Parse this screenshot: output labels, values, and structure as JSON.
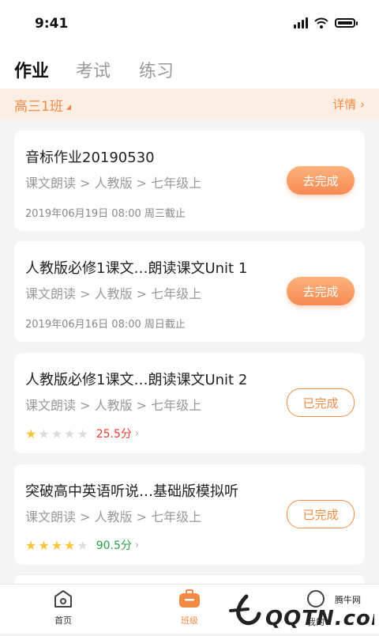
{
  "status": {
    "time": "9:41"
  },
  "tabs": [
    {
      "label": "作业",
      "active": true
    },
    {
      "label": "考试",
      "active": false
    },
    {
      "label": "练习",
      "active": false
    }
  ],
  "class_bar": {
    "name": "高三1班",
    "detail": "详情 ›"
  },
  "assignments": [
    {
      "title": "音标作业20190530",
      "path": "课文朗读 > 人教版 > 七年级上",
      "due": "2019年06月19日 08:00 周三截止",
      "button": "去完成"
    },
    {
      "title": "人教版必修1课文…朗读课文Unit 1",
      "path": "课文朗读 > 人教版 > 七年级上",
      "due": "2019年06月16日 08:00 周日截止",
      "button": "去完成"
    },
    {
      "title": "人教版必修1课文…朗读课文Unit 2",
      "path": "课文朗读 > 人教版 > 七年级上",
      "stars": 1,
      "score": "25.5分",
      "score_color": "#e8402f",
      "button": "已完成"
    },
    {
      "title": "突破高中英语听说…基础版模拟听",
      "path": "课文朗读 > 人教版 > 七年级上",
      "stars": 4,
      "score": "90.5分",
      "score_color": "#27a047",
      "button": "已完成"
    }
  ],
  "bottom_nav": [
    {
      "label": "首页",
      "active": false
    },
    {
      "label": "班级",
      "active": true
    },
    {
      "label": "我的",
      "active": false
    }
  ],
  "watermark": {
    "brand": "腾牛网",
    "text": "QQTN.com"
  },
  "colors": {
    "accent": "#f08a45",
    "background": "#f4f4f4"
  }
}
